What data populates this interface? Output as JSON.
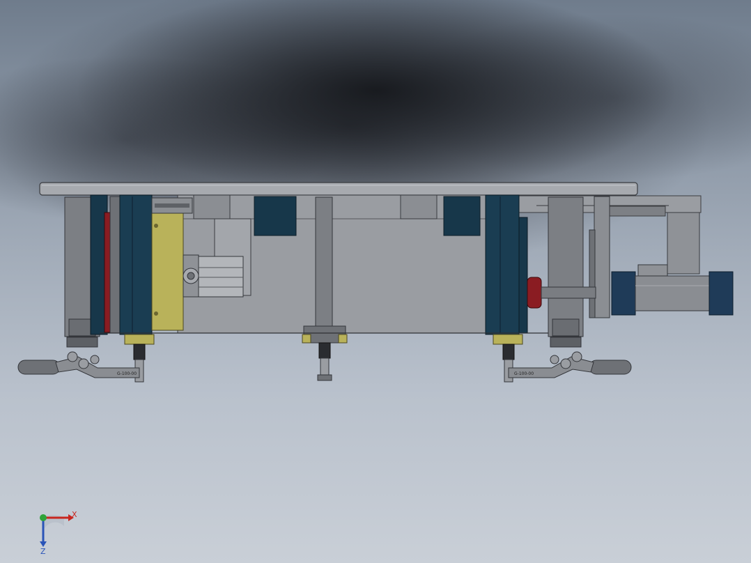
{
  "viewport": {
    "model_parts": [
      "top-plate",
      "right-rail-plate",
      "left-upright",
      "left-clamp-block",
      "left-gearbox",
      "linear-slide",
      "center-column",
      "right-clamp-block",
      "right-upright",
      "cylinder",
      "left-toggle-clamp",
      "right-toggle-clamp"
    ],
    "clamp_labels": {
      "left": "G-100-00",
      "right": "G-100-00"
    },
    "colors": {
      "steel": "#8a8d92",
      "steel_dark": "#6e7176",
      "navy": "#17374a",
      "olive": "#b9b25a",
      "crimson": "#8a1c22",
      "cylinder": "#7a7d82",
      "cylinder_cap": "#1f3b58"
    }
  },
  "triad": {
    "x_label": "X",
    "z_label": "Z",
    "x_color": "#c8261f",
    "y_color": "#2fa33a",
    "z_color": "#2a54b8"
  }
}
